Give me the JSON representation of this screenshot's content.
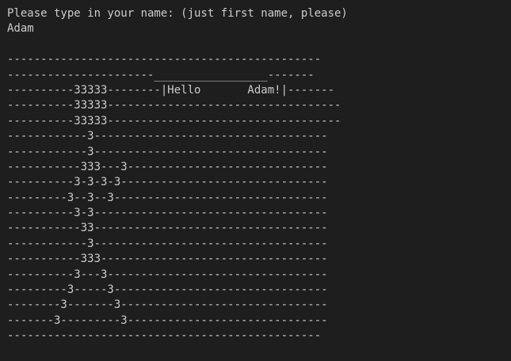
{
  "terminal": {
    "text_color": "#cccccc",
    "background_color": "#1e1e1e",
    "lines": [
      "Please type in your name: (just first name, please)",
      "Adam",
      "",
      "-----------------------------------------------",
      "----------------------_________________-------",
      "----------33333--------|Hello       Adam!|-------",
      "----------33333-----------------------------------",
      "----------33333-----------------------------------",
      "------------3-----------------------------------",
      "------------3-----------------------------------",
      "-----------333---3------------------------------",
      "----------3-3-3-3-------------------------------",
      "---------3--3--3--------------------------------",
      "----------3-3-----------------------------------",
      "-----------33-----------------------------------",
      "------------3-----------------------------------",
      "-----------333----------------------------------",
      "----------3---3---------------------------------",
      "---------3-----3--------------------------------",
      "--------3-------3-------------------------------",
      "-------3---------3------------------------------",
      "-----------------------------------------------"
    ]
  }
}
